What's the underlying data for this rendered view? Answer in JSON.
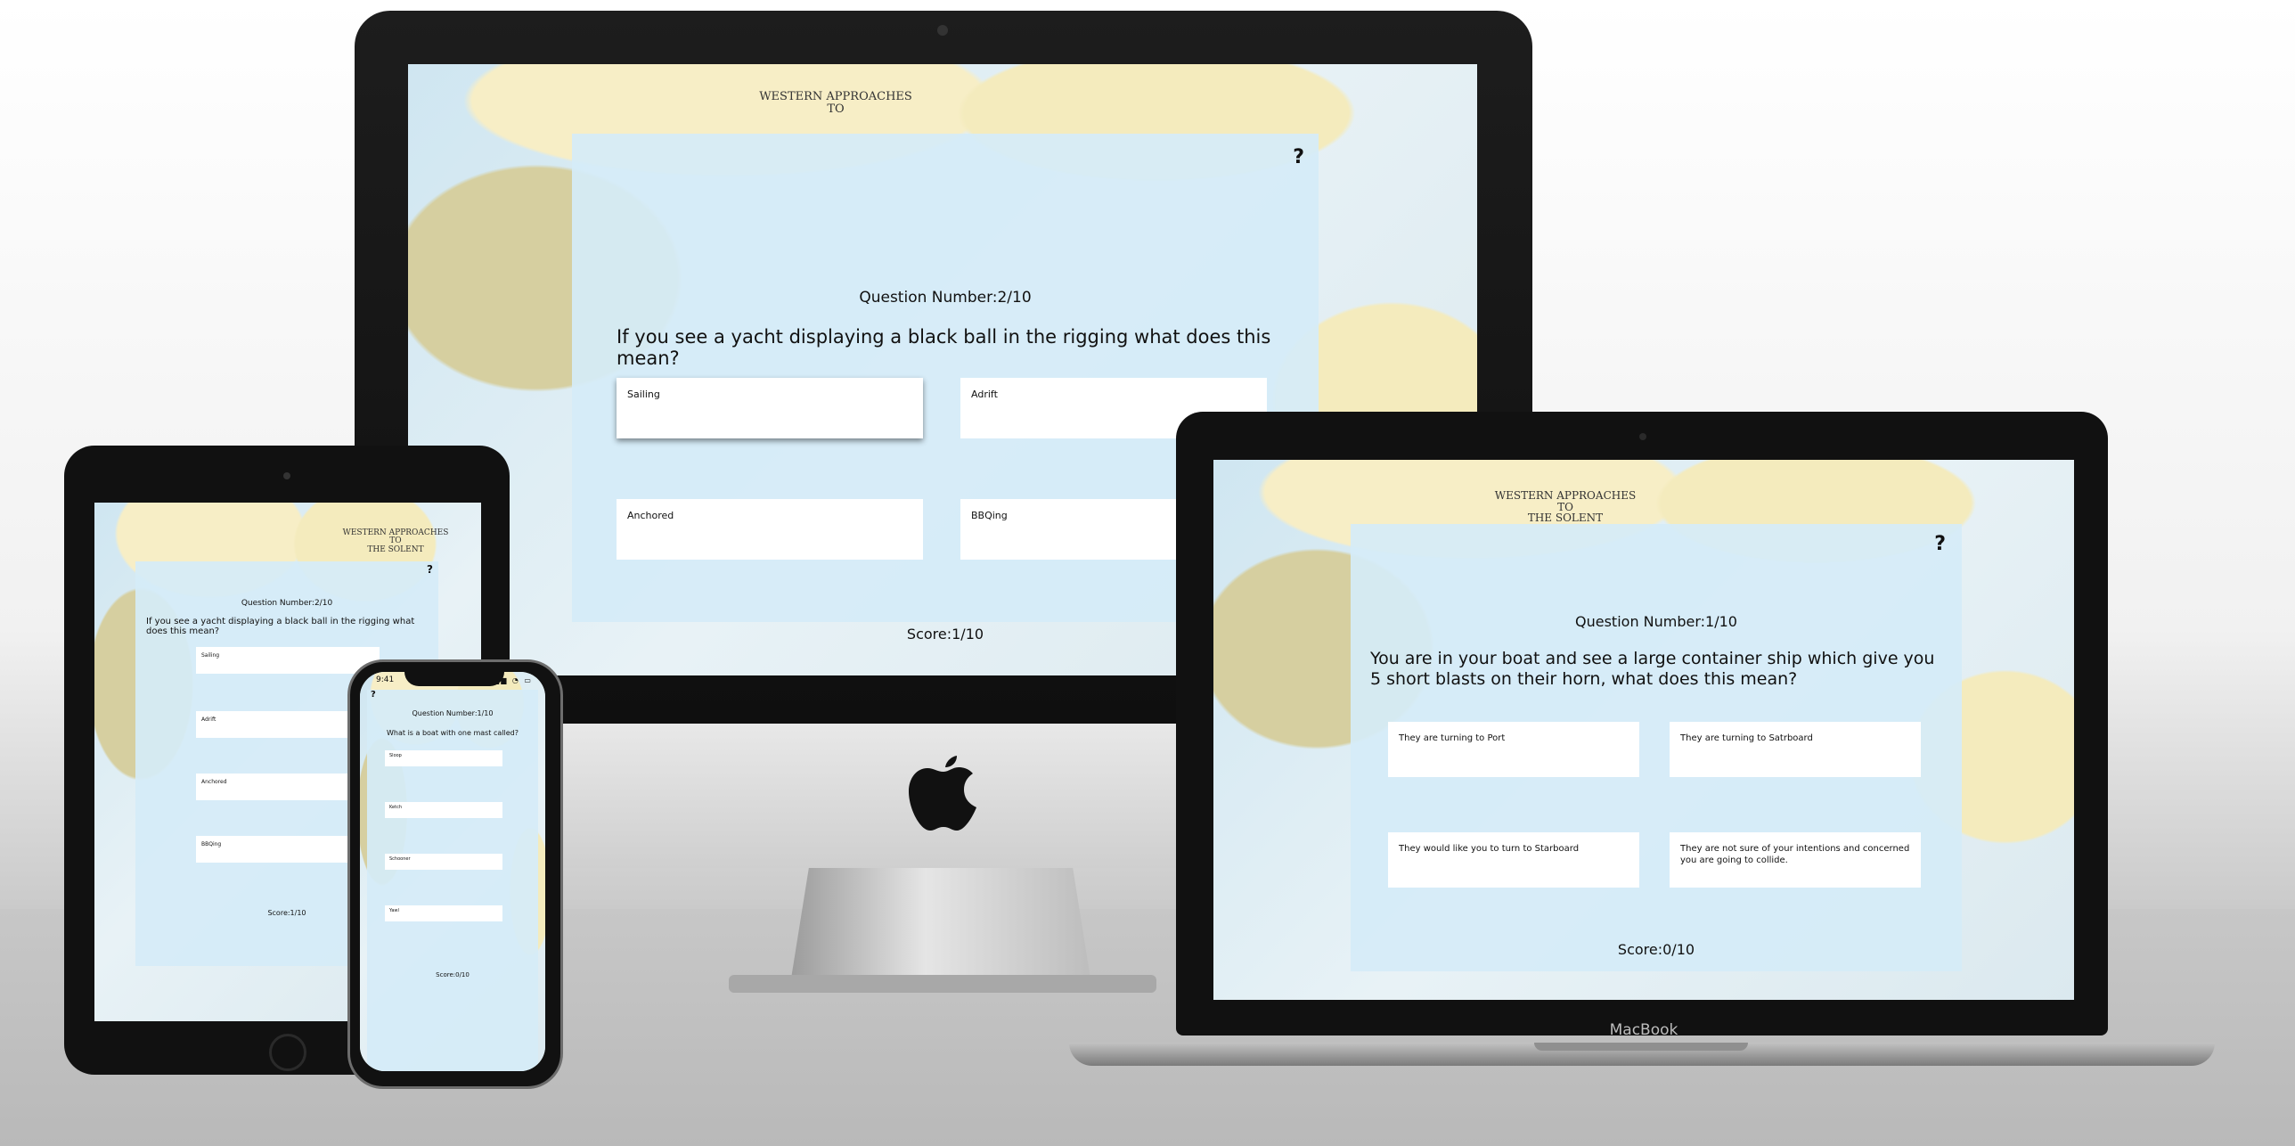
{
  "imac": {
    "chart_title_lines": [
      "WESTERN APPROACHES",
      "TO"
    ],
    "quiz": {
      "help_label": "?",
      "question_number": "Question Number:2/10",
      "question": "If you see a yacht displaying a black ball in the rigging what does this mean?",
      "answers": [
        "Sailing",
        "Adrift",
        "Anchored",
        "BBQing"
      ],
      "score": "Score:1/10"
    }
  },
  "macbook": {
    "brand": "MacBook",
    "chart_title_lines": [
      "WESTERN APPROACHES",
      "TO",
      "THE SOLENT"
    ],
    "quiz": {
      "help_label": "?",
      "question_number": "Question Number:1/10",
      "question": "You are in your boat and see a large container ship which give you 5 short blasts on their horn, what does this mean?",
      "answers": [
        "They are turning to Port",
        "They are turning to Satrboard",
        "They would like you to turn to Starboard",
        "They are not sure of your intentions and concerned you are going to collide."
      ],
      "score": "Score:0/10"
    }
  },
  "ipad": {
    "chart_title_lines": [
      "WESTERN APPROACHES",
      "TO",
      "THE SOLENT"
    ],
    "quiz": {
      "help_label": "?",
      "question_number": "Question Number:2/10",
      "question": "If you see a yacht displaying a black ball in the rigging what does this mean?",
      "answers": [
        "Sailing",
        "Adrift",
        "Anchored",
        "BBQing"
      ],
      "score": "Score:1/10"
    }
  },
  "phone": {
    "status_time": "9:41",
    "status_icons": "▂▄▆ ◔ ▭",
    "quiz": {
      "help_label": "?",
      "question_number": "Question Number:1/10",
      "question": "What is a boat with one mast called?",
      "answers": [
        "Sloop",
        "Ketch",
        "Schooner",
        "Yawl"
      ],
      "score": "Score:0/10"
    }
  }
}
